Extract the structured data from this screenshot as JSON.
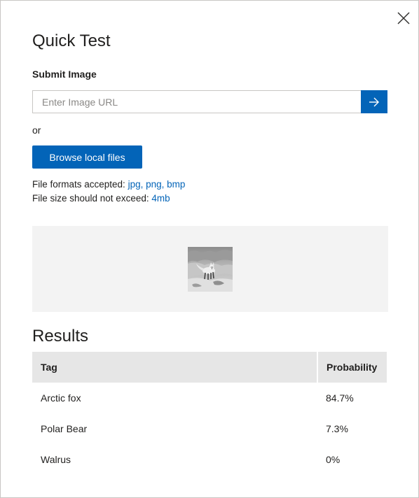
{
  "dialog": {
    "title": "Quick Test",
    "close_icon": "close-icon"
  },
  "submit": {
    "label": "Submit Image",
    "url_placeholder": "Enter Image URL",
    "url_value": "",
    "submit_icon": "arrow-right-icon",
    "or_text": "or",
    "browse_label": "Browse local files"
  },
  "formats": {
    "label": "File formats accepted:",
    "list": "jpg, png, bmp"
  },
  "size": {
    "label": "File size should not exceed:",
    "limit": "4mb"
  },
  "preview": {
    "image_icon": "arctic-fox-thumbnail"
  },
  "results": {
    "title": "Results",
    "columns": [
      "Tag",
      "Probability"
    ],
    "rows": [
      {
        "tag": "Arctic fox",
        "probability": "84.7%"
      },
      {
        "tag": "Polar Bear",
        "probability": "7.3%"
      },
      {
        "tag": "Walrus",
        "probability": "0%"
      }
    ]
  },
  "colors": {
    "accent": "#0364b8",
    "preview_bg": "#f3f3f3",
    "table_header_bg": "#e6e6e6",
    "border": "#c8c6c4"
  }
}
